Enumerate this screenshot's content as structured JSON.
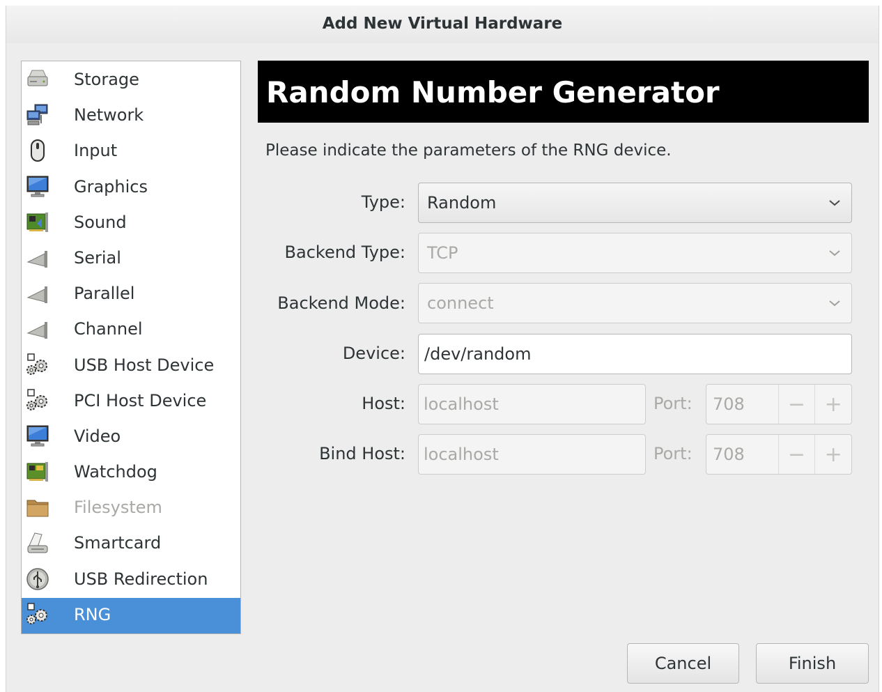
{
  "window": {
    "title": "Add New Virtual Hardware"
  },
  "devices": [
    {
      "label": "Storage",
      "icon": "storage-icon",
      "state": "normal"
    },
    {
      "label": "Network",
      "icon": "network-icon",
      "state": "normal"
    },
    {
      "label": "Input",
      "icon": "mouse-icon",
      "state": "normal"
    },
    {
      "label": "Graphics",
      "icon": "monitor-icon",
      "state": "normal"
    },
    {
      "label": "Sound",
      "icon": "sound-card-icon",
      "state": "normal"
    },
    {
      "label": "Serial",
      "icon": "serial-plug-icon",
      "state": "normal"
    },
    {
      "label": "Parallel",
      "icon": "parallel-plug-icon",
      "state": "normal"
    },
    {
      "label": "Channel",
      "icon": "channel-plug-icon",
      "state": "normal"
    },
    {
      "label": "USB Host Device",
      "icon": "gears-icon",
      "state": "normal"
    },
    {
      "label": "PCI Host Device",
      "icon": "gears-icon",
      "state": "normal"
    },
    {
      "label": "Video",
      "icon": "monitor-icon",
      "state": "normal"
    },
    {
      "label": "Watchdog",
      "icon": "card-icon",
      "state": "normal"
    },
    {
      "label": "Filesystem",
      "icon": "folder-icon",
      "state": "disabled"
    },
    {
      "label": "Smartcard",
      "icon": "smartcard-icon",
      "state": "normal"
    },
    {
      "label": "USB Redirection",
      "icon": "usb-icon",
      "state": "normal"
    },
    {
      "label": "RNG",
      "icon": "gears-icon",
      "state": "selected"
    }
  ],
  "panel": {
    "title": "Random Number Generator",
    "intro": "Please indicate the parameters of the RNG device.",
    "type": {
      "label": "Type:",
      "value": "Random"
    },
    "backend_type": {
      "label": "Backend Type:",
      "value": "TCP"
    },
    "backend_mode": {
      "label": "Backend Mode:",
      "value": "connect"
    },
    "device": {
      "label": "Device:",
      "value": "/dev/random"
    },
    "host": {
      "label": "Host:",
      "value": "localhost",
      "port_label": "Port:",
      "port": "708"
    },
    "bind_host": {
      "label": "Bind Host:",
      "value": "localhost",
      "port_label": "Port:",
      "port": "708"
    }
  },
  "buttons": {
    "cancel": "Cancel",
    "finish": "Finish"
  },
  "colors": {
    "selection": "#4a90d9",
    "banner": "#000000",
    "window_bg": "#ededed"
  }
}
